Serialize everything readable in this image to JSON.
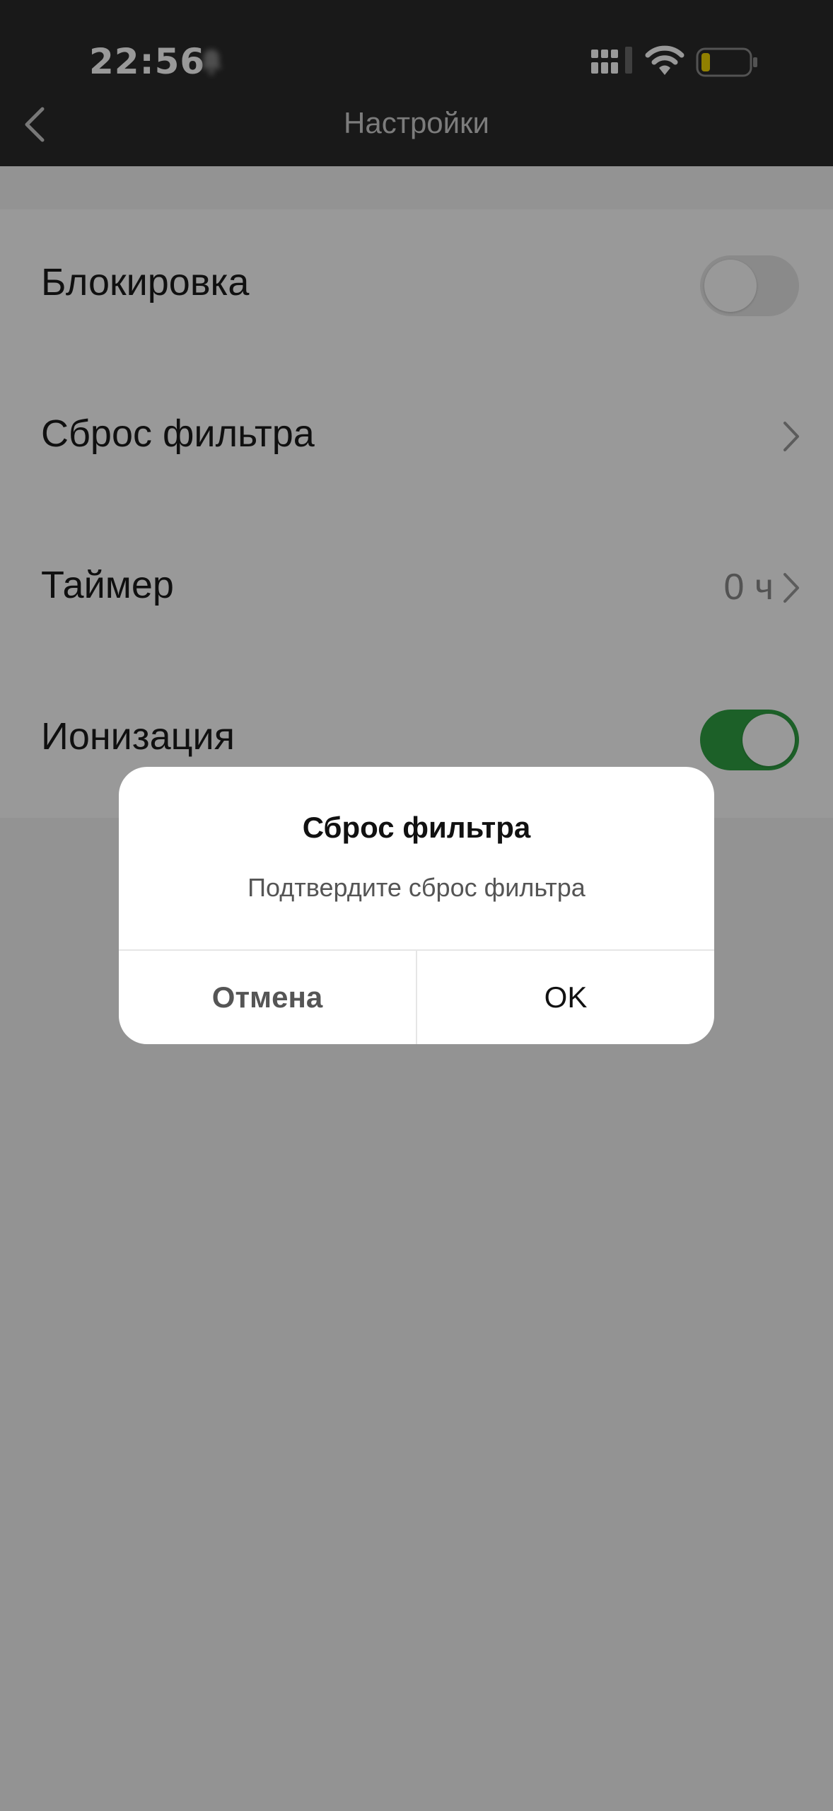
{
  "status_bar": {
    "time": "22:56",
    "colors": {
      "battery_level": "#f2d600"
    }
  },
  "nav": {
    "title": "Настройки"
  },
  "settings": {
    "items": [
      {
        "label": "Блокировка",
        "control": "toggle",
        "state": "off"
      },
      {
        "label": "Сброс фильтра",
        "control": "chevron"
      },
      {
        "label": "Таймер",
        "control": "value-chevron",
        "value": "0 ч"
      },
      {
        "label": "Ионизация",
        "control": "toggle",
        "state": "on"
      }
    ],
    "colors": {
      "toggle_on": "#30a043",
      "toggle_off": "#e6e6e6"
    }
  },
  "dialog": {
    "title": "Сброс фильтра",
    "message": "Подтвердите сброс фильтра",
    "cancel_label": "Отмена",
    "ok_label": "OK"
  },
  "icons": [
    "bell-icon",
    "signal-icon",
    "wifi-icon",
    "battery-icon",
    "back-icon",
    "chevron-right-icon"
  ]
}
